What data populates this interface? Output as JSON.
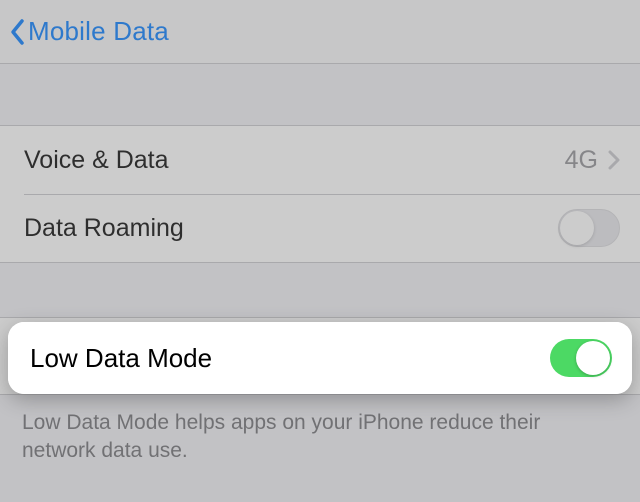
{
  "nav": {
    "back_title": "Mobile Data"
  },
  "cells": {
    "voice_data": {
      "label": "Voice & Data",
      "value": "4G"
    },
    "data_roaming": {
      "label": "Data Roaming",
      "on": false
    },
    "low_data_mode": {
      "label": "Low Data Mode",
      "on": true
    }
  },
  "footer": {
    "text": "Low Data Mode helps apps on your iPhone reduce their network data use."
  },
  "colors": {
    "tint": "#007aff",
    "toggle_on": "#4cd964"
  }
}
